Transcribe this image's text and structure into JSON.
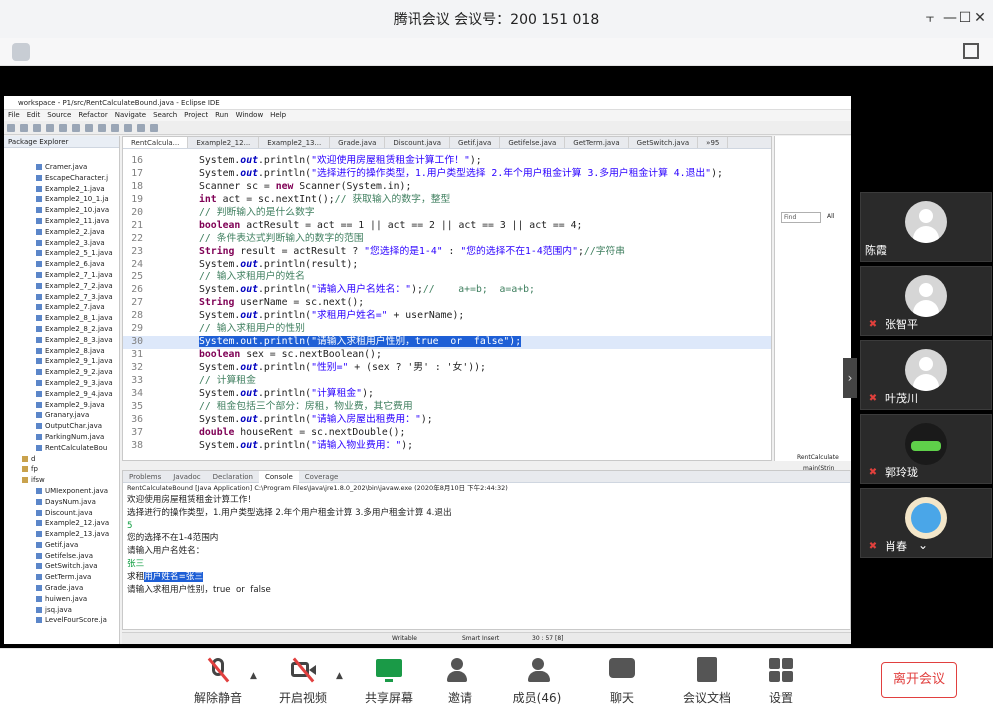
{
  "window": {
    "title": "腾讯会议 会议号：200 151 018",
    "controls": [
      "pin-icon",
      "minimize-icon",
      "maximize-icon",
      "close-icon"
    ]
  },
  "eclipse": {
    "title": "workspace - P1/src/RentCalculateBound.java - Eclipse IDE",
    "menu": [
      "File",
      "Edit",
      "Source",
      "Refactor",
      "Navigate",
      "Search",
      "Project",
      "Run",
      "Window",
      "Help"
    ],
    "package_explorer": {
      "title": "Package Explorer",
      "items": [
        "Cramer.java",
        "EscapeCharacter.j",
        "Example2_1.java",
        "Example2_10_1.ja",
        "Example2_10.java",
        "Example2_11.java",
        "Example2_2.java",
        "Example2_3.java",
        "Example2_5_1.java",
        "Example2_6.java",
        "Example2_7_1.java",
        "Example2_7_2.java",
        "Example2_7_3.java",
        "Example2_7.java",
        "Example2_8_1.java",
        "Example2_8_2.java",
        "Example2_8_3.java",
        "Example2_8.java",
        "Example2_9_1.java",
        "Example2_9_2.java",
        "Example2_9_3.java",
        "Example2_9_4.java",
        "Example2_9.java",
        "Granary.java",
        "OutputChar.java",
        "ParkingNum.java",
        "RentCalculateBou",
        "d",
        "fp",
        "ifsw",
        "UMIexponent.java",
        "DaysNum.java",
        "Discount.java",
        "Example2_12.java",
        "Example2_13.java",
        "Getif.java",
        "Getifelse.java",
        "GetSwitch.java",
        "GetTerm.java",
        "Grade.java",
        "huiwen.java",
        "jsq.java",
        "LevelFourScore.ja"
      ]
    },
    "editor_tabs": [
      "RentCalcula...",
      "Example2_12...",
      "Example2_13...",
      "Grade.java",
      "Discount.java",
      "Getif.java",
      "Getifelse.java",
      "GetTerm.java",
      "GetSwitch.java",
      "»95"
    ],
    "code_lines": [
      {
        "n": "16",
        "text": "System.out.println(\"欢迎使用房屋租赁租金计算工作！\");"
      },
      {
        "n": "17",
        "text": "System.out.println(\"选择进行的操作类型，1.用户类型选择 2.年个用户租金计算 3.多用户租金计算 4.退出\");"
      },
      {
        "n": "18",
        "text": "Scanner sc = new Scanner(System.in);"
      },
      {
        "n": "19",
        "text": "int act = sc.nextInt();// 获取输入的数字，整型"
      },
      {
        "n": "20",
        "text": "// 判断输入的是什么数字"
      },
      {
        "n": "21",
        "text": "boolean actResult = act == 1 || act == 2 || act == 3 || act == 4;"
      },
      {
        "n": "22",
        "text": "// 条件表达式判断输入的数字的范围"
      },
      {
        "n": "23",
        "text": "String result = actResult ? \"您选择的是1-4\" : \"您的选择不在1-4范围内\";//字符串"
      },
      {
        "n": "24",
        "text": "System.out.println(result);"
      },
      {
        "n": "25",
        "text": "// 输入求租用户的姓名"
      },
      {
        "n": "26",
        "text": "System.out.println(\"请输入用户名姓名：\");//    a+=b;  a=a+b;"
      },
      {
        "n": "27",
        "text": "String userName = sc.next();"
      },
      {
        "n": "28",
        "text": "System.out.println(\"求租用户姓名=\" + userName);"
      },
      {
        "n": "29",
        "text": "// 输入求租用户的性别"
      },
      {
        "n": "30",
        "text": "System.out.println(\"请输入求租用户性别，true  or  false\");"
      },
      {
        "n": "31",
        "text": "boolean sex = sc.nextBoolean();"
      },
      {
        "n": "32",
        "text": "System.out.println(\"性别=\" + (sex ? '男' : '女'));"
      },
      {
        "n": "33",
        "text": "// 计算租金"
      },
      {
        "n": "34",
        "text": "System.out.println(\"计算租金\");"
      },
      {
        "n": "35",
        "text": "// 租金包括三个部分：房租，物业费，其它费用"
      },
      {
        "n": "36",
        "text": "System.out.println(\"请输入房屋出租费用：\");"
      },
      {
        "n": "37",
        "text": "double houseRent = sc.nextDouble();"
      },
      {
        "n": "38",
        "text": "System.out.println(\"请输入物业费用：\");"
      }
    ],
    "outline_find": "Find",
    "outline_all": "All",
    "outline_class": "RentCalculate",
    "outline_method": "main(Strin",
    "console": {
      "tabs": [
        "Problems",
        "Javadoc",
        "Declaration",
        "Console",
        "Coverage"
      ],
      "path": "RentCalculateBound [Java Application] C:\\Program Files\\Java\\jre1.8.0_202\\bin\\javaw.exe (2020年8月10日 下午2:44:32)",
      "lines": [
        {
          "text": "欢迎使用房屋租赁租金计算工作！",
          "type": "normal"
        },
        {
          "text": "选择进行的操作类型，1.用户类型选择 2.年个用户租金计算 3.多用户租金计算 4.退出",
          "type": "normal"
        },
        {
          "text": "5",
          "type": "input"
        },
        {
          "text": "您的选择不在1-4范围内",
          "type": "normal"
        },
        {
          "text": "请输入用户名姓名：",
          "type": "normal"
        },
        {
          "text": "张三",
          "type": "input"
        },
        {
          "text_pre": "求租",
          "text_sel": "用户姓名=张三",
          "type": "selected"
        },
        {
          "text": "请输入求租用户性别，true  or  false",
          "type": "normal"
        }
      ]
    },
    "status": {
      "writable": "Writable",
      "insert": "Smart Insert",
      "position": "30 : 57 [8]"
    }
  },
  "participants": [
    {
      "name": "陈霞",
      "muted": false,
      "avatar": "default"
    },
    {
      "name": "张智平",
      "muted": true,
      "avatar": "default"
    },
    {
      "name": "叶茂川",
      "muted": true,
      "avatar": "default"
    },
    {
      "name": "郭玲珑",
      "muted": true,
      "avatar": "car"
    },
    {
      "name": "肖春",
      "muted": true,
      "avatar": "doraemon"
    }
  ],
  "toolbar": {
    "unmute": "解除静音",
    "video": "开启视频",
    "share": "共享屏幕",
    "invite": "邀请",
    "members": "成员(46)",
    "chat": "聊天",
    "docs": "会议文档",
    "settings": "设置",
    "leave": "离开会议"
  },
  "colors": {
    "share_green": "#1a9a47",
    "leave_red": "#e1403f",
    "selection_blue": "#1e5fd6"
  }
}
